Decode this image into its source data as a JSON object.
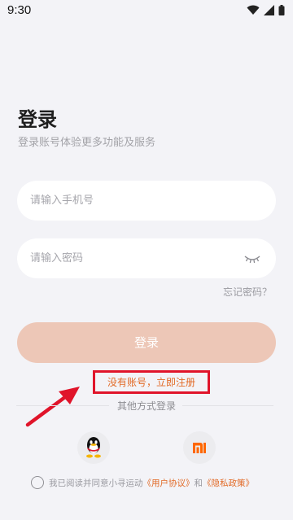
{
  "status_bar": {
    "time": "9:30"
  },
  "login": {
    "title": "登录",
    "subtitle": "登录账号体验更多功能及服务",
    "phone_placeholder": "请输入手机号",
    "password_placeholder": "请输入密码",
    "forgot_password": "忘记密码？",
    "login_button": "登录",
    "register_link": "没有账号，立即注册",
    "other_methods": "其他方式登录"
  },
  "social": [
    {
      "icon": "qq-penguin-icon"
    },
    {
      "icon": "xiaomi-logo-icon",
      "brand_color": "#ff6700"
    }
  ],
  "agreement": {
    "prefix": "我已阅读并同意小寻运动",
    "user_agreement": "《用户协议》",
    "and": "和",
    "privacy_policy": "《隐私政策》"
  },
  "colors": {
    "accent_orange": "#e26a27",
    "login_button_bg": "#edc7b7",
    "annotation_red": "#e0142a",
    "background": "#f3f3f7"
  }
}
